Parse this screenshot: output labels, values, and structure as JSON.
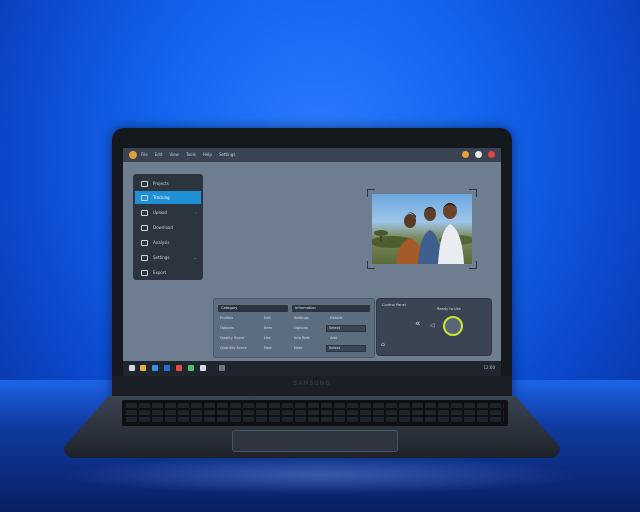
{
  "app": {
    "menu": [
      "File",
      "Edit",
      "View",
      "Tools",
      "Help",
      "Settings"
    ],
    "window_controls": [
      "#e6a23c",
      "#e6e6e6",
      "#e04545"
    ]
  },
  "sidebar": {
    "items": [
      {
        "label": "Projects",
        "icon": "folder-icon"
      },
      {
        "label": "Tracking",
        "icon": "monitor-icon",
        "active": true
      },
      {
        "label": "Upload",
        "icon": "upload-icon"
      },
      {
        "label": "Download",
        "icon": "download-icon"
      },
      {
        "label": "Analysis",
        "icon": "chart-icon"
      },
      {
        "label": "Settings",
        "icon": "gear-icon"
      },
      {
        "label": "Export",
        "icon": "export-icon"
      }
    ]
  },
  "table": {
    "col1_header": "Category",
    "col2_header": "Information",
    "rows": [
      [
        "Profiles",
        "Edit",
        "Settings",
        "Details"
      ],
      [
        "Options",
        "Item",
        "Options",
        "Select"
      ],
      [
        "Quality Score",
        "Use",
        "Info Rule",
        "Add"
      ],
      [
        "Quantity Score",
        "New",
        "Note",
        "Select"
      ]
    ]
  },
  "control_panel": {
    "title": "Control Panel",
    "status": "Ready to Use"
  },
  "taskbar": {
    "clock": "12:00"
  },
  "brand": "SAMSUNG",
  "colors": {
    "accent": "#1f8fd6",
    "knob_ring": "#c8e635"
  }
}
